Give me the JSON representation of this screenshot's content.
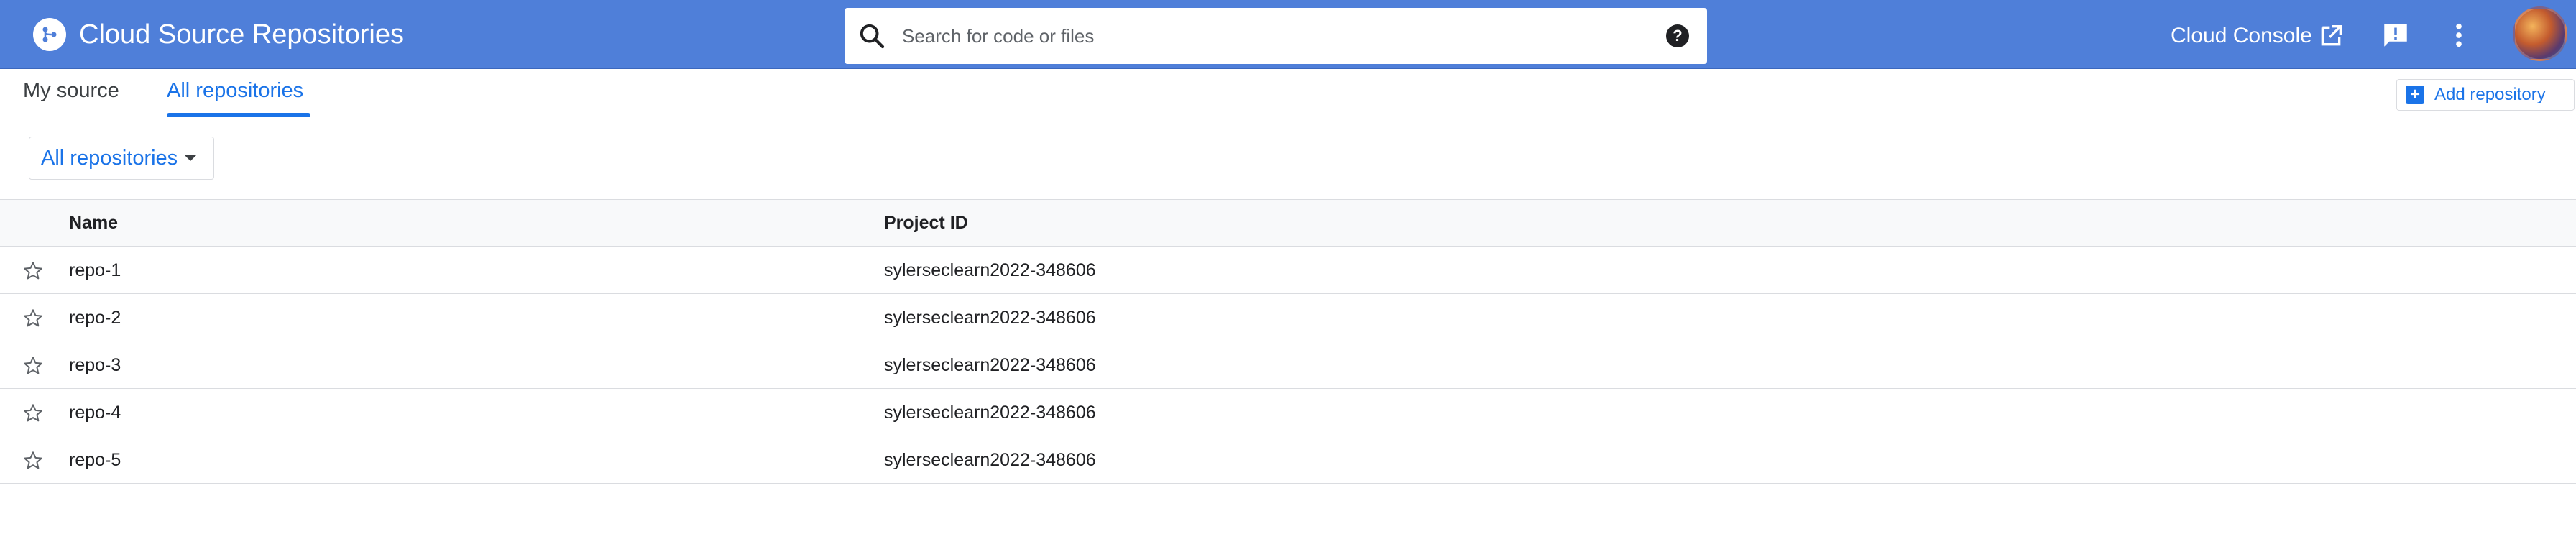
{
  "header": {
    "title": "Cloud Source Repositories",
    "logo_icon": "cloud-source-repositories-logo",
    "search": {
      "placeholder": "Search for code or files",
      "value": ""
    },
    "console_link_label": "Cloud Console",
    "colors": {
      "bar": "#4f7fd9",
      "accent": "#1a73e8"
    }
  },
  "tabs": [
    {
      "label": "My source",
      "active": false
    },
    {
      "label": "All repositories",
      "active": true
    }
  ],
  "toolbar": {
    "add_repository_label": "Add repository"
  },
  "filter": {
    "selected": "All repositories"
  },
  "table": {
    "columns": [
      "Name",
      "Project ID"
    ],
    "rows": [
      {
        "name": "repo-1",
        "project_id": "sylerseclearn2022-348606",
        "starred": false
      },
      {
        "name": "repo-2",
        "project_id": "sylerseclearn2022-348606",
        "starred": false
      },
      {
        "name": "repo-3",
        "project_id": "sylerseclearn2022-348606",
        "starred": false
      },
      {
        "name": "repo-4",
        "project_id": "sylerseclearn2022-348606",
        "starred": false
      },
      {
        "name": "repo-5",
        "project_id": "sylerseclearn2022-348606",
        "starred": false
      }
    ]
  }
}
